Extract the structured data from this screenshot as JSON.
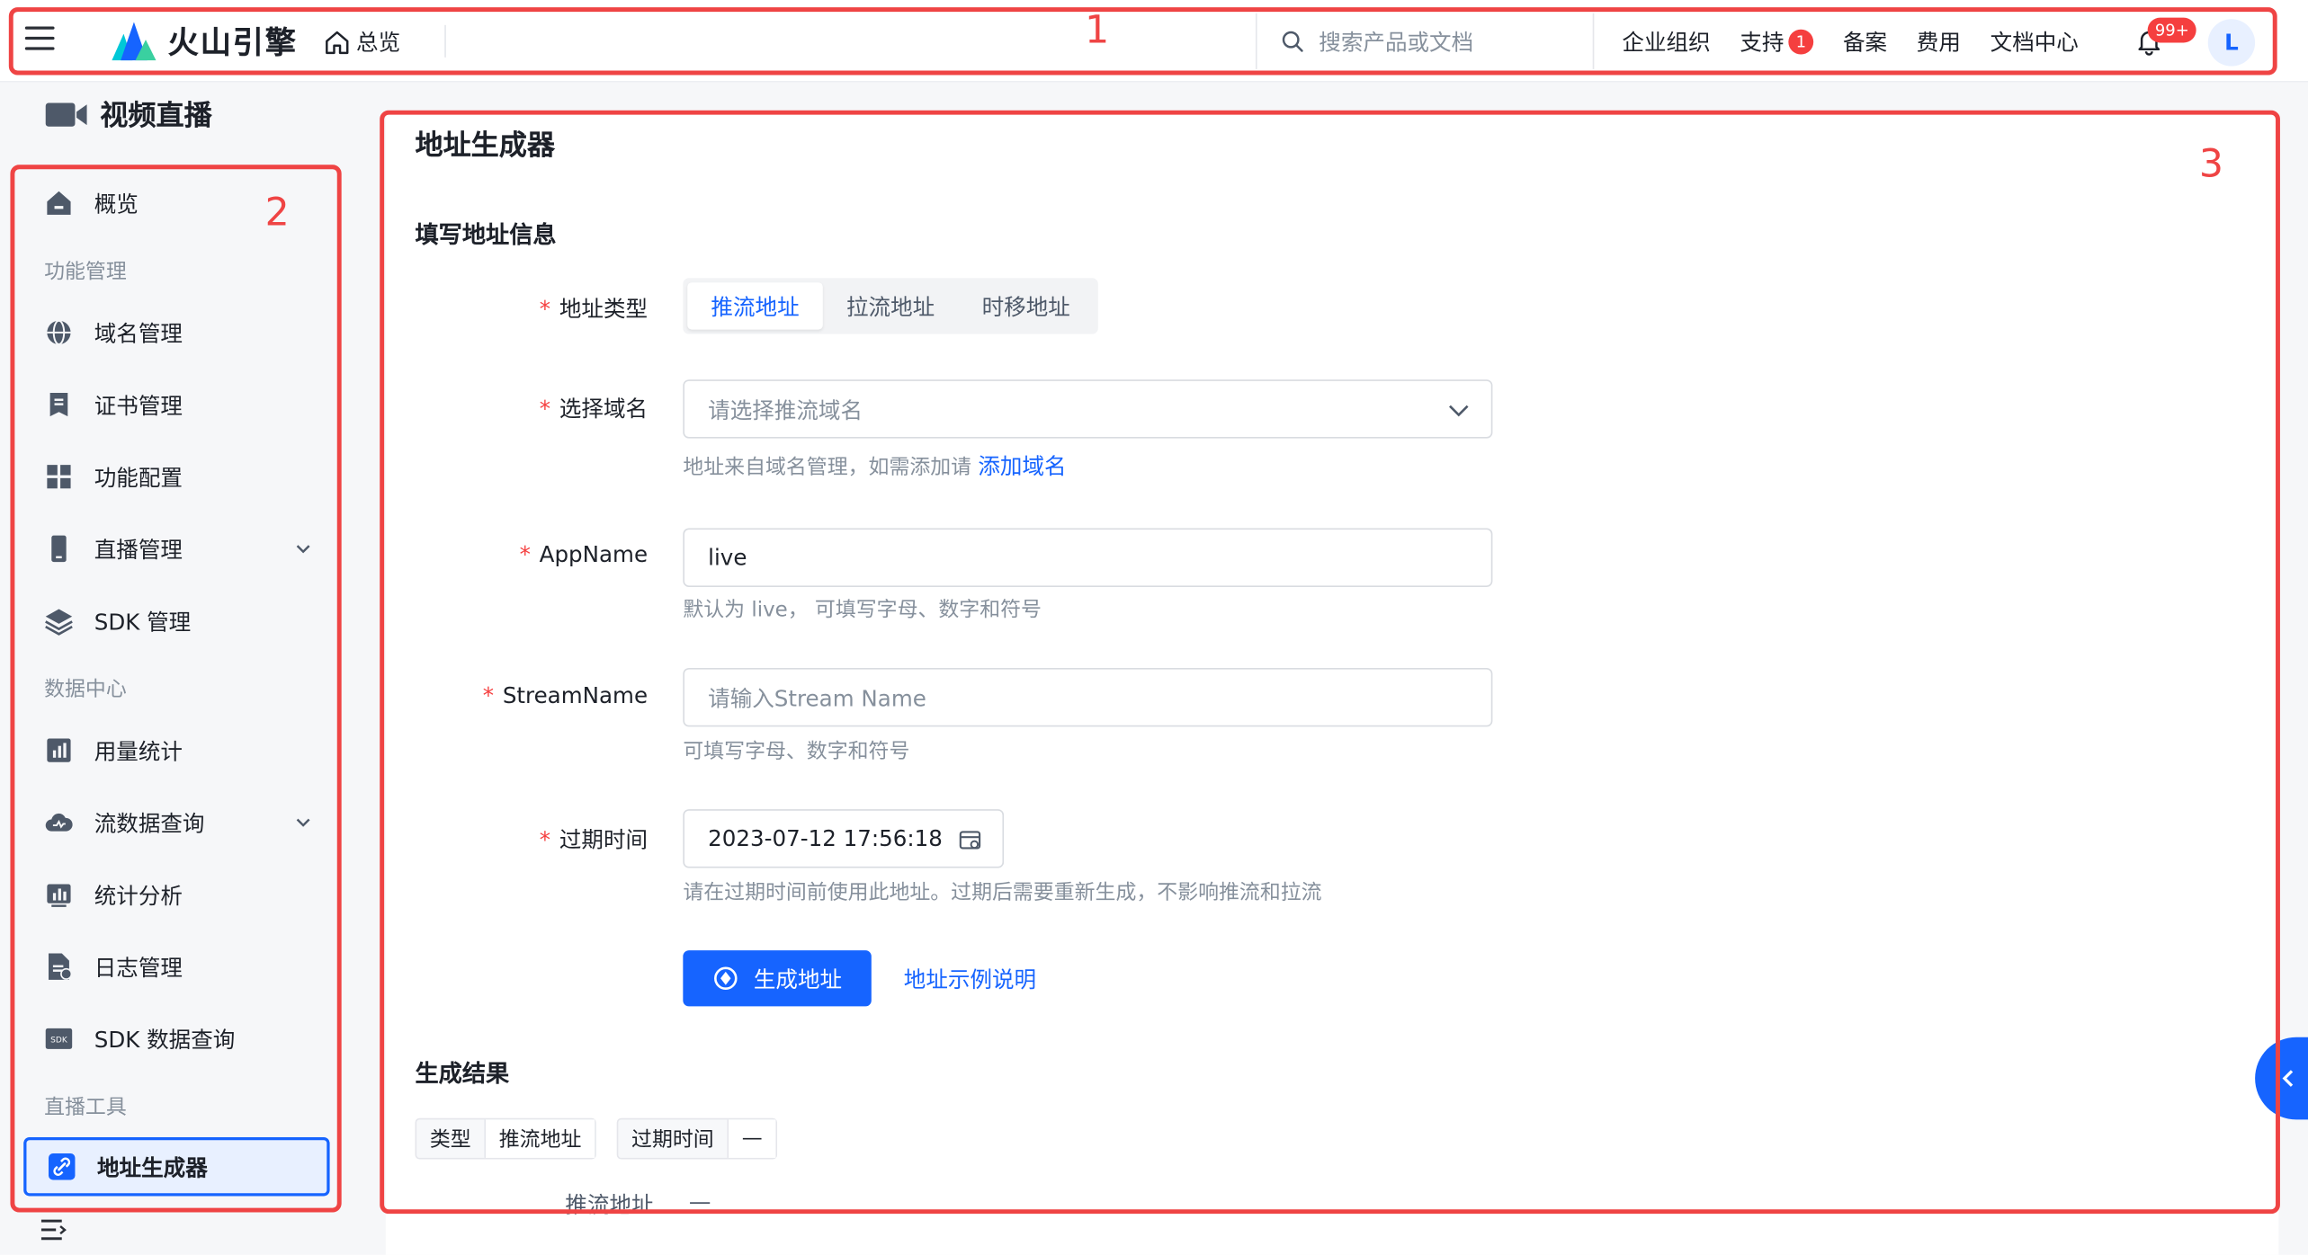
{
  "topbar": {
    "brand": "火山引擎",
    "home_label": "总览",
    "search_placeholder": "搜索产品或文档",
    "nav": {
      "org": "企业组织",
      "support": "支持",
      "support_badge": "1",
      "filing": "备案",
      "billing": "费用",
      "docs": "文档中心"
    },
    "notification_badge": "99+",
    "avatar_letter": "L"
  },
  "sidebar": {
    "product_title": "视频直播",
    "overview": "概览",
    "group_function": "功能管理",
    "domain_mgmt": "域名管理",
    "cert_mgmt": "证书管理",
    "feature_config": "功能配置",
    "live_mgmt": "直播管理",
    "sdk_mgmt": "SDK 管理",
    "group_data": "数据中心",
    "usage_stats": "用量统计",
    "stream_query": "流数据查询",
    "stats_analysis": "统计分析",
    "log_mgmt": "日志管理",
    "sdk_data_query": "SDK 数据查询",
    "group_tools": "直播工具",
    "address_generator": "地址生成器"
  },
  "main": {
    "page_title": "地址生成器",
    "section_fill": "填写地址信息",
    "address_type_label": "地址类型",
    "address_type_options": [
      "推流地址",
      "拉流地址",
      "时移地址"
    ],
    "domain_label": "选择域名",
    "domain_placeholder": "请选择推流域名",
    "domain_hint": "地址来自域名管理，如需添加请",
    "domain_hint_link": "添加域名",
    "appname_label": "AppName",
    "appname_value": "live",
    "appname_hint": "默认为 live， 可填写字母、数字和符号",
    "streamname_label": "StreamName",
    "streamname_placeholder": "请输入Stream Name",
    "streamname_hint": "可填写字母、数字和符号",
    "expire_label": "过期时间",
    "expire_value": "2023-07-12 17:56:18",
    "expire_hint": "请在过期时间前使用此地址。过期后需要重新生成，不影响推流和拉流",
    "generate_button": "生成地址",
    "example_link": "地址示例说明",
    "section_result": "生成结果",
    "tag_type_key": "类型",
    "tag_type_val": "推流地址",
    "tag_expire_key": "过期时间",
    "tag_expire_val": "—",
    "result_label": "推流地址",
    "result_value": "—"
  },
  "annotations": [
    "1",
    "2",
    "3"
  ],
  "colors": {
    "accent": "#1664ff",
    "annotation": "#ef4444",
    "required": "#f53f3f"
  }
}
